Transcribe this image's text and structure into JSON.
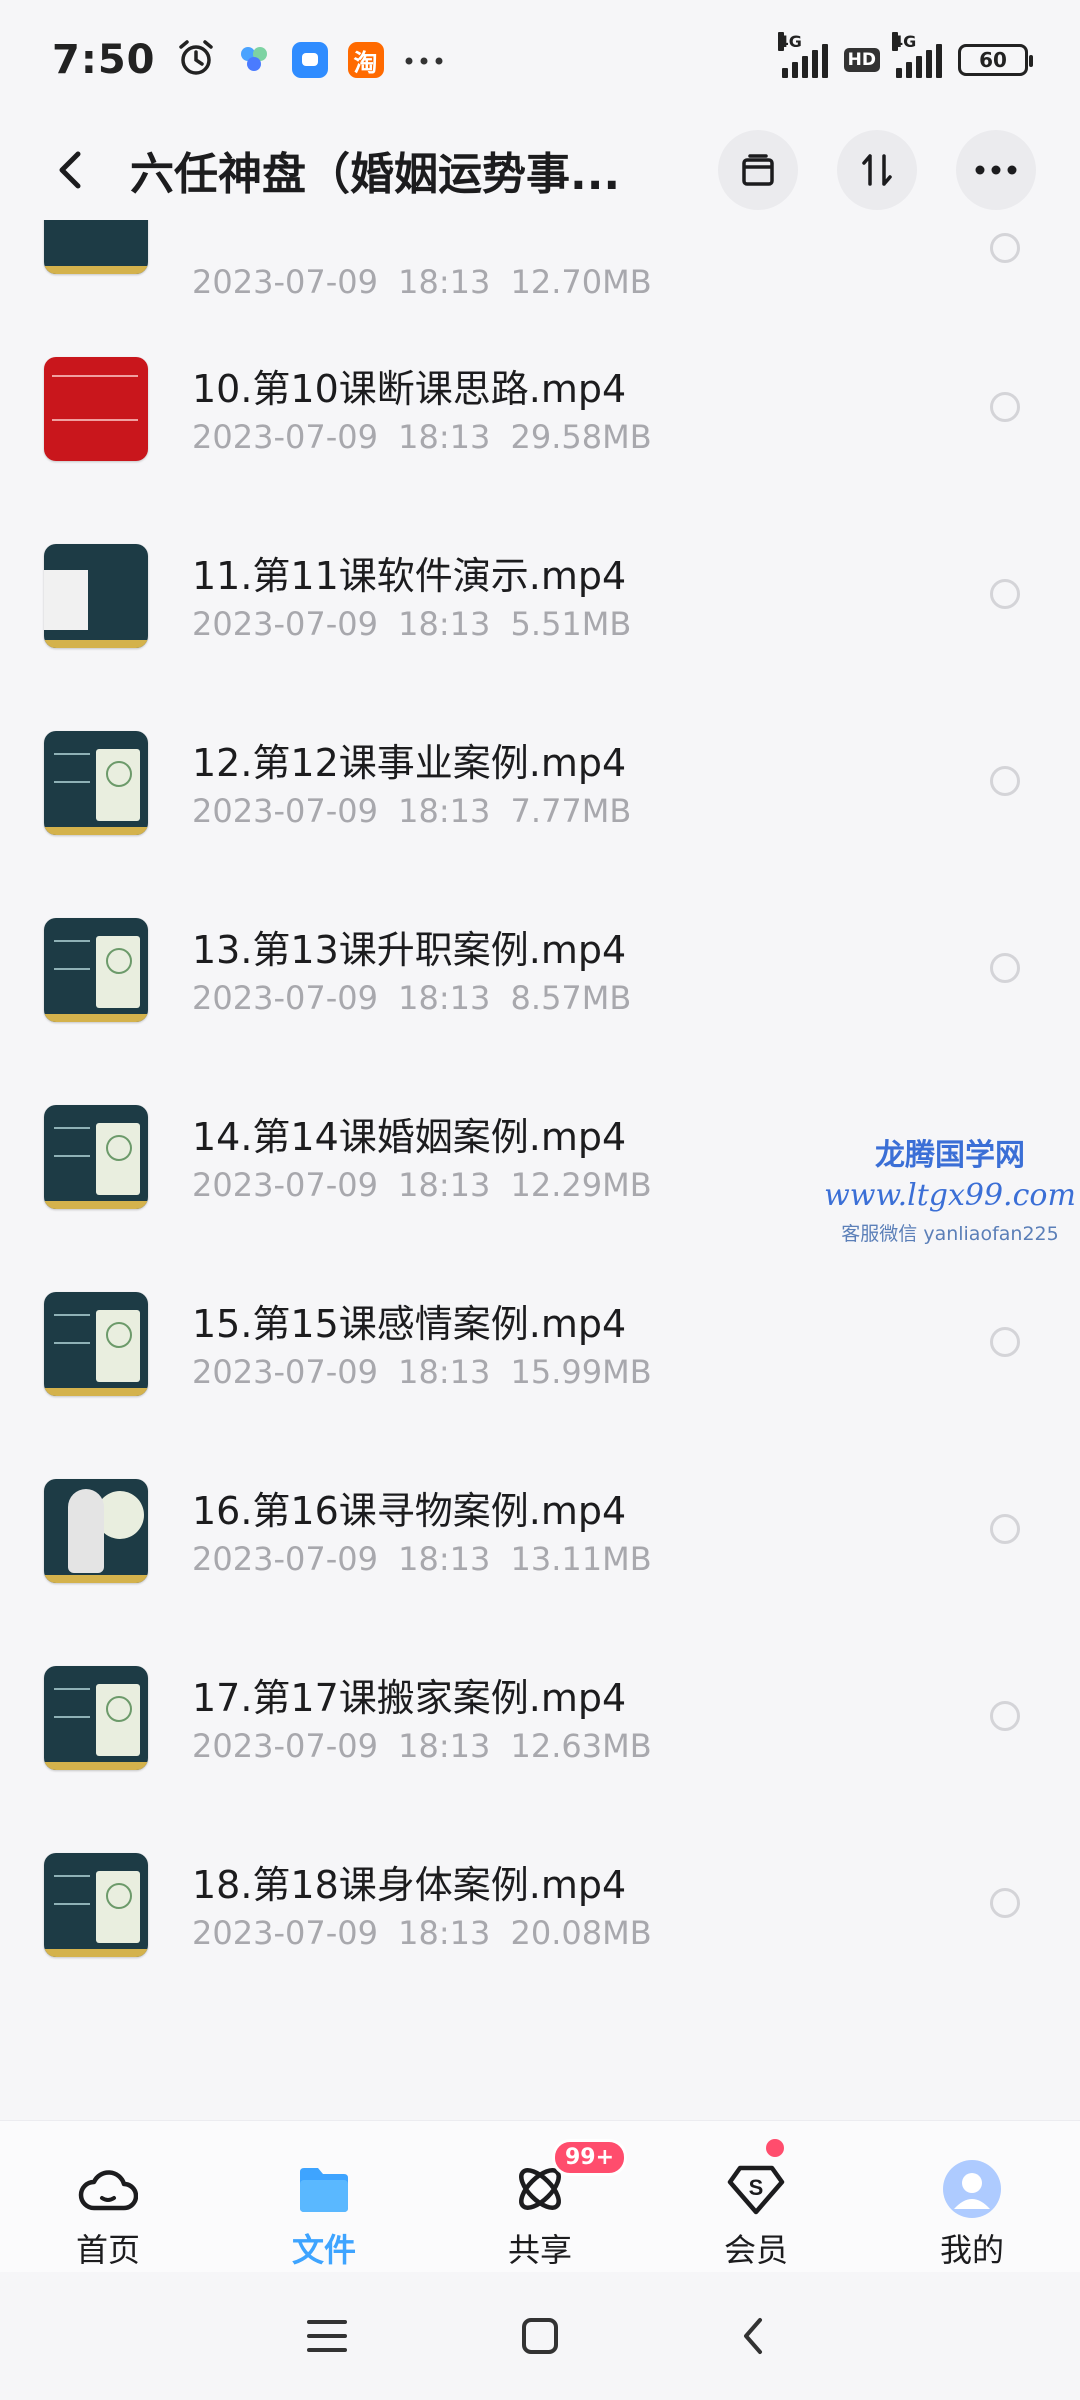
{
  "status_bar": {
    "time": "7:50",
    "net_1": "4G",
    "hd": "HD",
    "net_2": "4G",
    "battery": "60",
    "shopping_app": "淘"
  },
  "header": {
    "title": "六任神盘（婚姻运势事..."
  },
  "files": [
    {
      "name": "",
      "date": "2023-07-09",
      "time": "18:13",
      "size": "12.70MB",
      "thumb": "wheel"
    },
    {
      "name": "10.第10课断课思路.mp4",
      "date": "2023-07-09",
      "time": "18:13",
      "size": "29.58MB",
      "thumb": "red"
    },
    {
      "name": "11.第11课软件演示.mp4",
      "date": "2023-07-09",
      "time": "18:13",
      "size": "5.51MB",
      "thumb": "white"
    },
    {
      "name": "12.第12课事业案例.mp4",
      "date": "2023-07-09",
      "time": "18:13",
      "size": "7.77MB",
      "thumb": "slide"
    },
    {
      "name": "13.第13课升职案例.mp4",
      "date": "2023-07-09",
      "time": "18:13",
      "size": "8.57MB",
      "thumb": "slide"
    },
    {
      "name": "14.第14课婚姻案例.mp4",
      "date": "2023-07-09",
      "time": "18:13",
      "size": "12.29MB",
      "thumb": "slide"
    },
    {
      "name": "15.第15课感情案例.mp4",
      "date": "2023-07-09",
      "time": "18:13",
      "size": "15.99MB",
      "thumb": "slide"
    },
    {
      "name": "16.第16课寻物案例.mp4",
      "date": "2023-07-09",
      "time": "18:13",
      "size": "13.11MB",
      "thumb": "figure"
    },
    {
      "name": "17.第17课搬家案例.mp4",
      "date": "2023-07-09",
      "time": "18:13",
      "size": "12.63MB",
      "thumb": "slide"
    },
    {
      "name": "18.第18课身体案例.mp4",
      "date": "2023-07-09",
      "time": "18:13",
      "size": "20.08MB",
      "thumb": "slide"
    }
  ],
  "watermark": {
    "line1": "龙腾国学网",
    "line2": "www.ltgx99.com",
    "line3": "客服微信 yanliaofan225"
  },
  "bottom_nav": {
    "home": "首页",
    "files": "文件",
    "share": "共享",
    "share_badge": "99+",
    "vip": "会员",
    "me": "我的"
  },
  "colors": {
    "accent": "#3ea4ff",
    "badge": "#ff4d6d",
    "meta": "#a8a8ad"
  }
}
